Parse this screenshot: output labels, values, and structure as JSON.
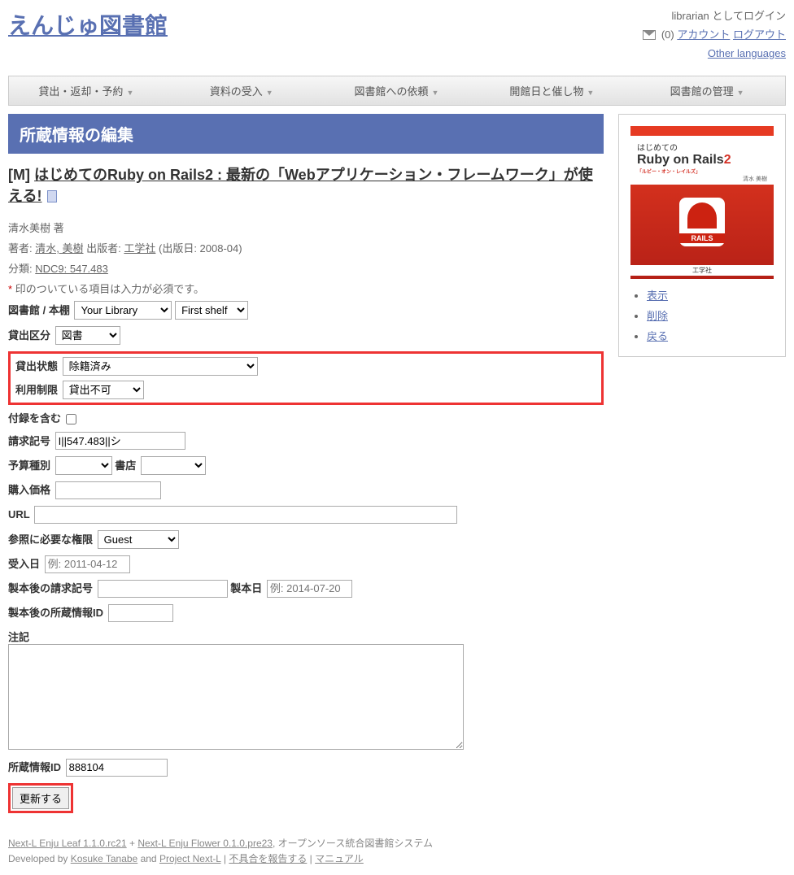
{
  "header": {
    "logo": "えんじゅ図書館",
    "login_status": "librarian としてログイン",
    "mail_count": "(0)",
    "account_link": "アカウント",
    "logout_link": "ログアウト",
    "other_lang": "Other languages"
  },
  "nav": {
    "items": [
      "貸出・返却・予約",
      "資料の受入",
      "図書館への依頼",
      "開館日と催し物",
      "図書館の管理"
    ]
  },
  "page": {
    "title": "所蔵情報の編集",
    "prefix": "[M]",
    "book_title": "はじめてのRuby on Rails2 : 最新の「Webアプリケーション・フレームワーク」が使える!",
    "author_line": "清水美樹 著",
    "authors_label": "著者:",
    "author_link": "清水, 美樹",
    "publisher_label": "出版者:",
    "publisher_link": "工学社",
    "pubdate": "(出版日: 2008-04)",
    "class_label": "分類:",
    "class_link": "NDC9: 547.483",
    "required_note": "印のついている項目は入力が必須です。"
  },
  "form": {
    "library_shelf_label": "図書館 / 本棚",
    "library_options": [
      "Your Library"
    ],
    "shelf_options": [
      "First shelf"
    ],
    "circ_type_label": "貸出区分",
    "circ_type_options": [
      "図書"
    ],
    "circ_status_label": "貸出状態",
    "circ_status_options": [
      "除籍済み"
    ],
    "use_restriction_label": "利用制限",
    "use_restriction_options": [
      "貸出不可"
    ],
    "include_supplements_label": "付録を含む",
    "call_number_label": "請求記号",
    "call_number_value": "I||547.483||シ",
    "budget_type_label": "予算種別",
    "budget_type_options": [
      ""
    ],
    "bookstore_label": "書店",
    "bookstore_options": [
      ""
    ],
    "price_label": "購入価格",
    "price_value": "",
    "url_label": "URL",
    "url_value": "",
    "role_label": "参照に必要な権限",
    "role_options": [
      "Guest"
    ],
    "acquired_label": "受入日",
    "acquired_placeholder": "例: 2011-04-12",
    "binding_call_label": "製本後の請求記号",
    "binded_at_label": "製本日",
    "binded_at_placeholder": "例: 2014-07-20",
    "binding_item_label": "製本後の所蔵情報ID",
    "note_label": "注記",
    "note_value": "",
    "item_id_label": "所蔵情報ID",
    "item_id_value": "888104",
    "submit_label": "更新する"
  },
  "sidebar": {
    "cover": {
      "hajimete": "はじめての",
      "title": "Ruby on Rails",
      "two": "2",
      "sub": "「ルビー・オン・レイルズ」",
      "author": "清水 美樹",
      "publisher": "工学社"
    },
    "links": [
      "表示",
      "削除",
      "戻る"
    ]
  },
  "footer": {
    "link1": "Next-L Enju Leaf 1.1.0.rc21",
    "plus": " + ",
    "link2": "Next-L Enju Flower 0.1.0.pre23",
    "tagline": ", オープンソース統合図書館システム",
    "dev_by": "Developed by ",
    "dev_name": "Kosuke Tanabe",
    "and": " and ",
    "project": "Project Next-L",
    "sep": " | ",
    "report": "不具合を報告する",
    "manual": "マニュアル"
  }
}
